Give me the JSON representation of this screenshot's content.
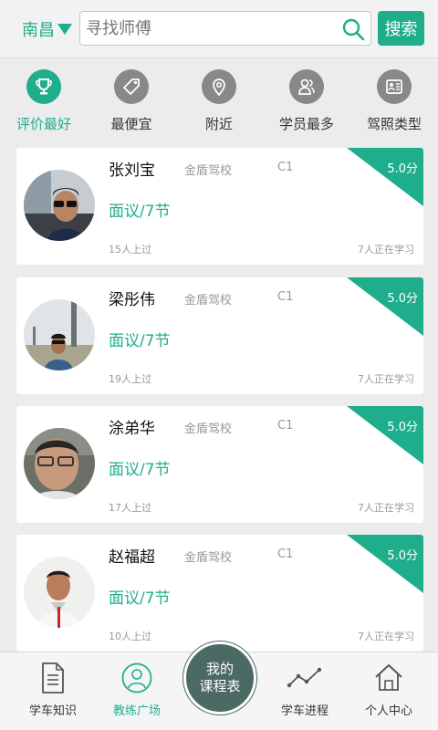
{
  "header": {
    "city": "南昌",
    "search_placeholder": "寻找师傅",
    "search_button": "搜索"
  },
  "filters": [
    {
      "label": "评价最好",
      "icon": "trophy-icon",
      "active": true
    },
    {
      "label": "最便宜",
      "icon": "price-tag-icon",
      "active": false
    },
    {
      "label": "附近",
      "icon": "location-pin-icon",
      "active": false
    },
    {
      "label": "学员最多",
      "icon": "people-icon",
      "active": false
    },
    {
      "label": "驾照类型",
      "icon": "license-card-icon",
      "active": false
    }
  ],
  "coaches": [
    {
      "name": "张刘宝",
      "school": "金盾驾校",
      "license": "C1",
      "price": "面议/7节",
      "passed": "15人上过",
      "learning": "7人正在学习",
      "score": "5.0分"
    },
    {
      "name": "梁彤伟",
      "school": "金盾驾校",
      "license": "C1",
      "price": "面议/7节",
      "passed": "19人上过",
      "learning": "7人正在学习",
      "score": "5.0分"
    },
    {
      "name": "涂弟华",
      "school": "金盾驾校",
      "license": "C1",
      "price": "面议/7节",
      "passed": "17人上过",
      "learning": "7人正在学习",
      "score": "5.0分"
    },
    {
      "name": "赵福超",
      "school": "金盾驾校",
      "license": "C1",
      "price": "面议/7节",
      "passed": "10人上过",
      "learning": "7人正在学习",
      "score": "5.0分"
    }
  ],
  "bottom_nav": {
    "items": [
      {
        "label": "学车知识",
        "icon": "document-icon"
      },
      {
        "label": "教练广场",
        "icon": "coach-avatar-icon"
      },
      {
        "label": "学车进程",
        "icon": "progress-chart-icon"
      },
      {
        "label": "个人中心",
        "icon": "home-icon"
      }
    ],
    "center_line1": "我的",
    "center_line2": "课程表"
  },
  "colors": {
    "accent": "#1fae8c",
    "icon_gray": "#888888",
    "center_button": "#4b6a63"
  }
}
